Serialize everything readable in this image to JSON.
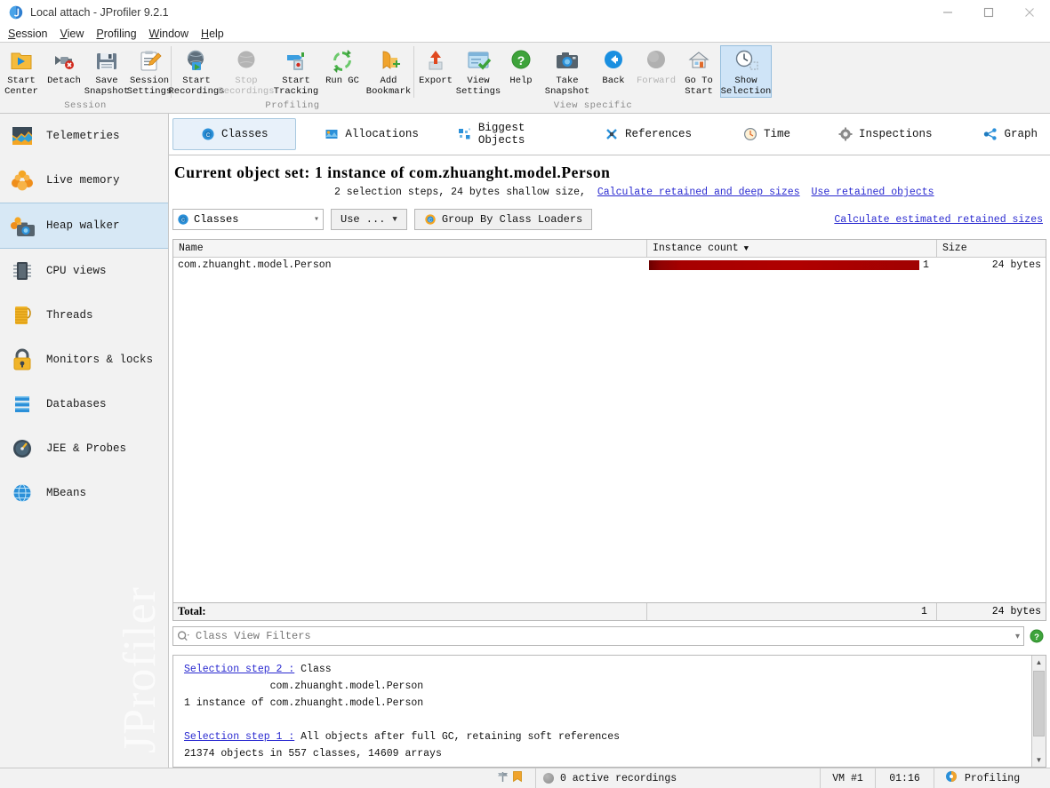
{
  "window": {
    "title": "Local attach - JProfiler 9.2.1",
    "app_icon": "jprofiler-icon",
    "controls": {
      "minimize": "minimize-icon",
      "maximize": "maximize-icon",
      "close": "close-icon"
    }
  },
  "menubar": [
    {
      "label": "Session",
      "mnemonic": "S"
    },
    {
      "label": "View",
      "mnemonic": "V"
    },
    {
      "label": "Profiling",
      "mnemonic": "P"
    },
    {
      "label": "Window",
      "mnemonic": "W"
    },
    {
      "label": "Help",
      "mnemonic": "H"
    }
  ],
  "toolbar": {
    "groups": [
      {
        "name": "Session",
        "items": [
          {
            "label": "Start\nCenter",
            "icon": "start-center-icon",
            "state": "enabled"
          },
          {
            "label": "Detach",
            "icon": "detach-icon",
            "state": "enabled"
          },
          {
            "label": "Save\nSnapshot",
            "icon": "save-snapshot-icon",
            "state": "enabled"
          },
          {
            "label": "Session\nSettings",
            "icon": "session-settings-icon",
            "state": "enabled"
          }
        ]
      },
      {
        "name": "Profiling",
        "items": [
          {
            "label": "Start\nRecordings",
            "icon": "start-recordings-icon",
            "state": "enabled"
          },
          {
            "label": "Stop\nRecordings",
            "icon": "stop-recordings-icon",
            "state": "disabled"
          },
          {
            "label": "Start\nTracking",
            "icon": "start-tracking-icon",
            "state": "enabled"
          },
          {
            "label": "Run GC",
            "icon": "run-gc-icon",
            "state": "enabled"
          },
          {
            "label": "Add\nBookmark",
            "icon": "add-bookmark-icon",
            "state": "enabled"
          }
        ]
      },
      {
        "name": "View specific",
        "items": [
          {
            "label": "Export",
            "icon": "export-icon",
            "state": "enabled"
          },
          {
            "label": "View\nSettings",
            "icon": "view-settings-icon",
            "state": "enabled"
          },
          {
            "label": "Help",
            "icon": "help-icon",
            "state": "enabled"
          },
          {
            "label": "Take\nSnapshot",
            "icon": "take-snapshot-icon",
            "state": "enabled"
          },
          {
            "label": "Back",
            "icon": "back-icon",
            "state": "enabled"
          },
          {
            "label": "Forward",
            "icon": "forward-icon",
            "state": "disabled"
          },
          {
            "label": "Go To\nStart",
            "icon": "go-to-start-icon",
            "state": "enabled"
          },
          {
            "label": "Show\nSelection",
            "icon": "show-selection-icon",
            "state": "selected"
          }
        ]
      }
    ]
  },
  "sidebar": {
    "items": [
      {
        "label": "Telemetries",
        "icon": "telemetries-icon",
        "active": false
      },
      {
        "label": "Live memory",
        "icon": "live-memory-icon",
        "active": false
      },
      {
        "label": "Heap walker",
        "icon": "heap-walker-icon",
        "active": true
      },
      {
        "label": "CPU views",
        "icon": "cpu-views-icon",
        "active": false
      },
      {
        "label": "Threads",
        "icon": "threads-icon",
        "active": false
      },
      {
        "label": "Monitors & locks",
        "icon": "monitors-locks-icon",
        "active": false
      },
      {
        "label": "Databases",
        "icon": "databases-icon",
        "active": false
      },
      {
        "label": "JEE & Probes",
        "icon": "jee-probes-icon",
        "active": false
      },
      {
        "label": "MBeans",
        "icon": "mbeans-icon",
        "active": false
      }
    ],
    "watermark": "JProfiler"
  },
  "tabs": [
    {
      "label": "Classes",
      "icon": "classes-icon",
      "active": true
    },
    {
      "label": "Allocations",
      "icon": "allocations-icon",
      "active": false
    },
    {
      "label": "Biggest Objects",
      "icon": "biggest-objects-icon",
      "active": false
    },
    {
      "label": "References",
      "icon": "references-icon",
      "active": false
    },
    {
      "label": "Time",
      "icon": "time-icon",
      "active": false
    },
    {
      "label": "Inspections",
      "icon": "inspections-icon",
      "active": false
    },
    {
      "label": "Graph",
      "icon": "graph-icon",
      "active": false
    }
  ],
  "object_set": {
    "heading": "Current object set: 1 instance of com.zhuanght.model.Person",
    "sub_text": "2 selection steps, 24 bytes shallow size,",
    "links": [
      "Calculate retained and deep sizes",
      "Use retained objects"
    ]
  },
  "controls": {
    "view_combo": {
      "value": "Classes",
      "icon": "classes-icon"
    },
    "use_button": {
      "label": "Use ...",
      "arrow": "chevron-down-icon"
    },
    "group_button": {
      "label": "Group By Class Loaders",
      "icon": "classes-icon"
    },
    "estimated_link": "Calculate estimated retained sizes"
  },
  "table": {
    "columns": [
      {
        "key": "name",
        "label": "Name",
        "sorted": false
      },
      {
        "key": "count",
        "label": "Instance count",
        "sorted": true,
        "sort_dir": "desc"
      },
      {
        "key": "size",
        "label": "Size",
        "sorted": false
      }
    ],
    "rows": [
      {
        "name": "com.zhuanght.model.Person",
        "count": "1",
        "count_pct": 100,
        "size": "24 bytes"
      }
    ],
    "bar_color": "#a60000",
    "total": {
      "label": "Total:",
      "count": "1",
      "size": "24 bytes"
    }
  },
  "filter": {
    "placeholder": "Class View Filters",
    "value": "",
    "icon": "search-icon",
    "dropdown": "chevron-down-icon",
    "help": "help-icon"
  },
  "details": {
    "lines": [
      {
        "link": "Selection step 2 :",
        "text": " Class",
        "indent": 0
      },
      {
        "link": "",
        "text": "              com.zhuanght.model.Person",
        "indent": 0
      },
      {
        "link": "",
        "text": "1 instance of com.zhuanght.model.Person",
        "indent": 0
      },
      {
        "link": "",
        "text": "",
        "indent": 0
      },
      {
        "link": "Selection step 1 :",
        "text": " All objects after full GC, retaining soft references",
        "indent": 0
      },
      {
        "link": "",
        "text": "21374 objects in 557 classes, 14609 arrays",
        "indent": 0
      }
    ]
  },
  "statusbar": {
    "recordings": "0 active recordings",
    "recordings_icon": "recording-off-icon",
    "vm": "VM #1",
    "time": "01:16",
    "profiling": "Profiling",
    "profiling_icon": "profiling-icon",
    "left_icons": [
      "signpost-icon",
      "bookmark-icon"
    ]
  }
}
